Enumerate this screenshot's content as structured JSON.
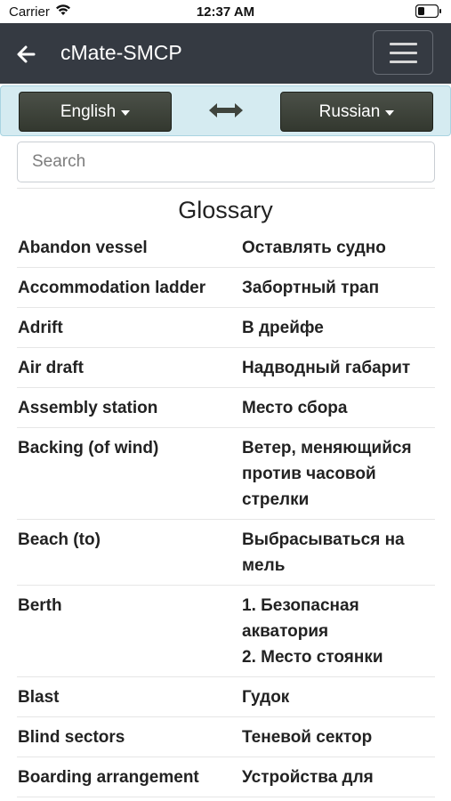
{
  "status_bar": {
    "carrier": "Carrier",
    "time": "12:37 AM"
  },
  "app_bar": {
    "title": "cMate-SMCP"
  },
  "language_bar": {
    "source_language": "English",
    "target_language": "Russian"
  },
  "search": {
    "placeholder": "Search",
    "value": ""
  },
  "glossary": {
    "title": "Glossary",
    "entries": [
      {
        "en": "Abandon vessel",
        "ru": "Оставлять судно"
      },
      {
        "en": "Accommodation ladder",
        "ru": "Забортный трап"
      },
      {
        "en": "Adrift",
        "ru": "В дрейфе"
      },
      {
        "en": "Air draft",
        "ru": "Надводный габарит"
      },
      {
        "en": "Assembly station",
        "ru": "Место сбора"
      },
      {
        "en": "Backing (of wind)",
        "ru": "Ветер, меняющийся против часовой стрелки"
      },
      {
        "en": "Beach (to)",
        "ru": "Выбрасываться на мель"
      },
      {
        "en": "Berth",
        "ru": "1. Безопасная акватория\n2. Место стоянки"
      },
      {
        "en": "Blast",
        "ru": "Гудок"
      },
      {
        "en": "Blind sectors",
        "ru": "Теневой сектор"
      },
      {
        "en": "Boarding arrangement",
        "ru": "Устройства для"
      }
    ]
  }
}
